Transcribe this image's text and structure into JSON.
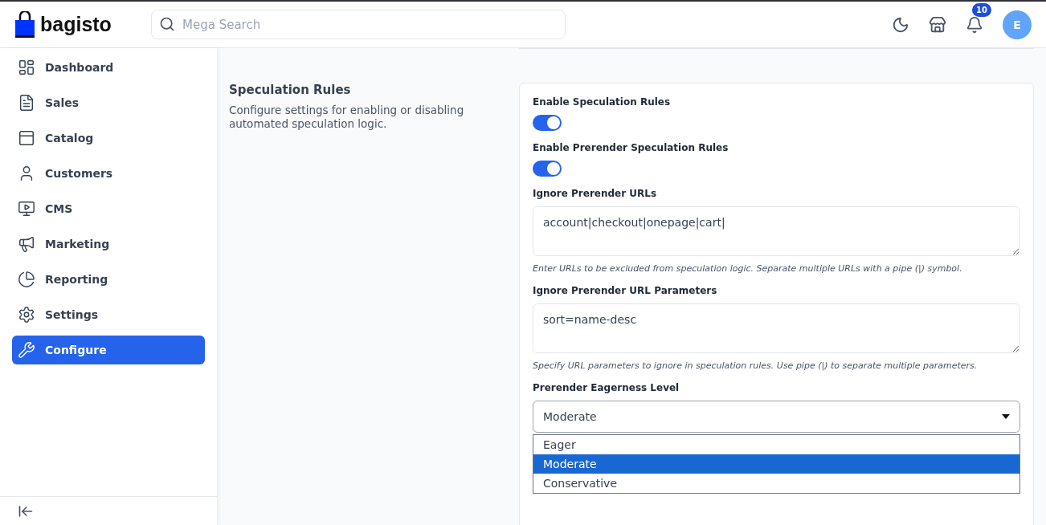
{
  "header": {
    "logo": "bagisto",
    "search": {
      "placeholder": "Mega Search"
    },
    "notification_count": "10",
    "avatar": "E"
  },
  "sidebar": {
    "items": [
      {
        "label": "Dashboard",
        "selected": false
      },
      {
        "label": "Sales",
        "selected": false
      },
      {
        "label": "Catalog",
        "selected": false
      },
      {
        "label": "Customers",
        "selected": false
      },
      {
        "label": "CMS",
        "selected": false
      },
      {
        "label": "Marketing",
        "selected": false
      },
      {
        "label": "Reporting",
        "selected": false
      },
      {
        "label": "Settings",
        "selected": false
      },
      {
        "label": "Configure",
        "selected": true
      }
    ]
  },
  "section": {
    "title": "Speculation Rules",
    "description": "Configure settings for enabling or disabling automated speculation logic.",
    "fields": [
      {
        "kind": "toggle",
        "label": "Enable Speculation Rules",
        "on": true
      },
      {
        "kind": "toggle",
        "label": "Enable Prerender Speculation Rules",
        "on": true
      },
      {
        "kind": "textarea",
        "label": "Ignore Prerender URLs",
        "value": "account|checkout|onepage|cart|",
        "hint": "Enter URLs to be excluded from speculation logic. Separate multiple URLs with a pipe (|) symbol."
      },
      {
        "kind": "textarea",
        "label": "Ignore Prerender URL Parameters",
        "value": "sort=name-desc",
        "hint": "Specify URL parameters to ignore in speculation rules. Use pipe (|) to separate multiple parameters."
      },
      {
        "kind": "select",
        "label": "Prerender Eagerness Level",
        "value": "Moderate",
        "expanded": true,
        "options": [
          {
            "label": "Eager",
            "selected": false
          },
          {
            "label": "Moderate",
            "selected": true
          },
          {
            "label": "Conservative",
            "selected": false
          }
        ]
      }
    ]
  }
}
